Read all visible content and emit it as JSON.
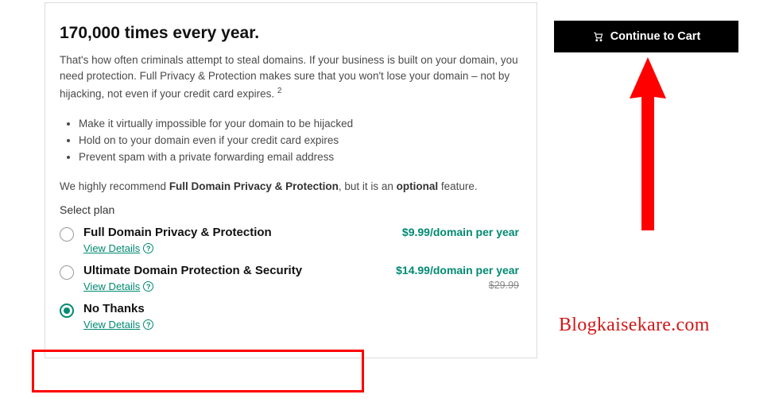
{
  "heading": "170,000 times every year.",
  "intro_text": "That's how often criminals attempt to steal domains. If your business is built on your domain, you need protection. Full Privacy & Protection makes sure that you won't lose your domain – not by hijacking, not even if your credit card expires. ",
  "intro_foot": "2",
  "bullets": [
    "Make it virtually impossible for your domain to be hijacked",
    "Hold on to your domain even if your credit card expires",
    "Prevent spam with a private forwarding email address"
  ],
  "recommend_prefix": "We highly recommend ",
  "recommend_bold1": "Full Domain Privacy & Protection",
  "recommend_mid": ", but it is an ",
  "recommend_bold2": "optional",
  "recommend_suffix": " feature.",
  "select_label": "Select plan",
  "view_details": "View Details",
  "plans": [
    {
      "title": "Full Domain Privacy & Protection",
      "price": "$9.99",
      "unit": "/domain per year",
      "strike": "",
      "selected": false
    },
    {
      "title": "Ultimate Domain Protection & Security",
      "price": "$14.99",
      "unit": "/domain per year",
      "strike": "$29.99",
      "selected": false
    },
    {
      "title": "No Thanks",
      "price": "",
      "unit": "",
      "strike": "",
      "selected": true
    }
  ],
  "cta_label": "Continue to Cart",
  "watermark": "Blogkaisekare.com"
}
